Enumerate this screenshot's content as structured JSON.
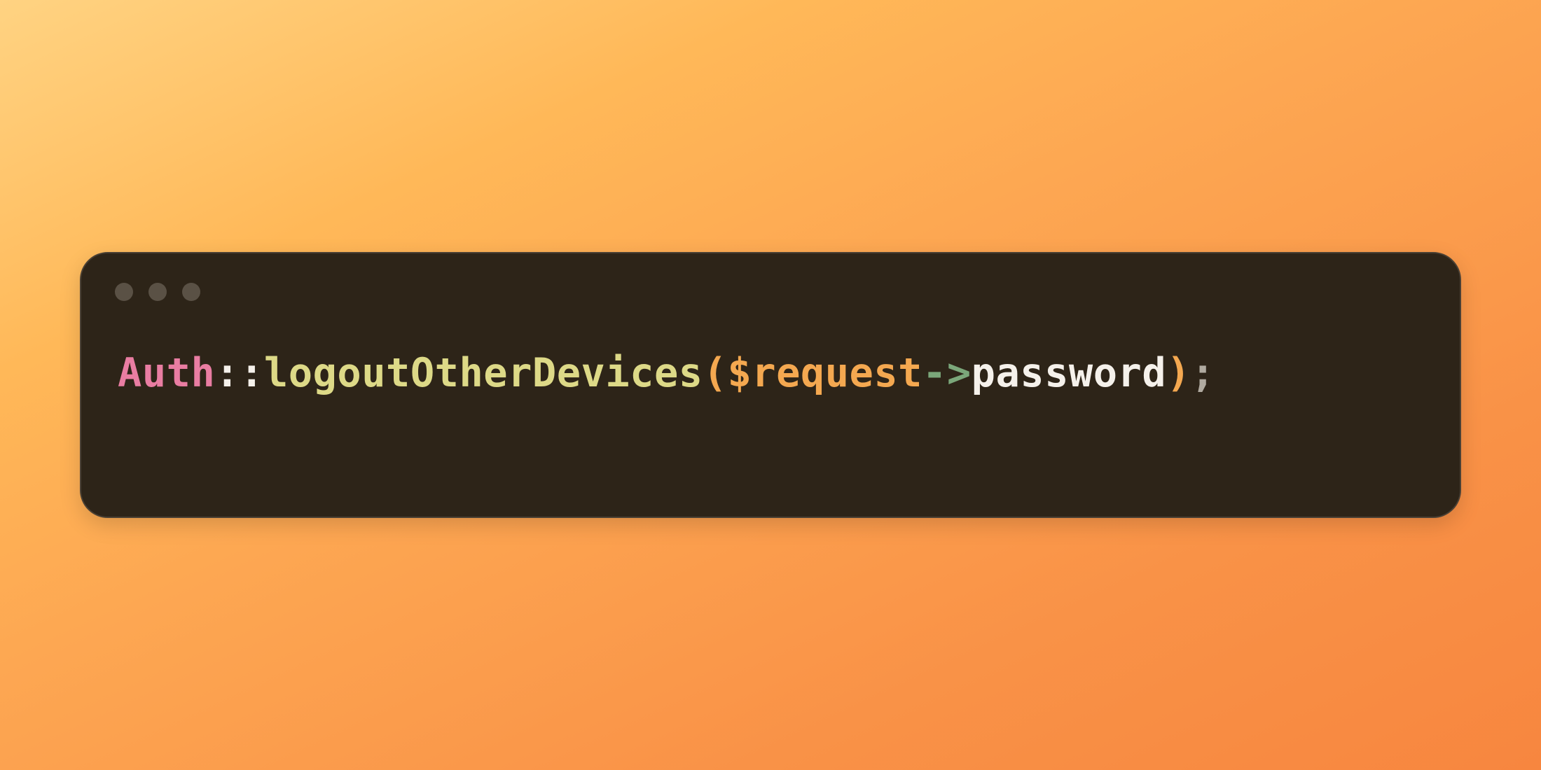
{
  "code": {
    "tokens": {
      "class_name": "Auth",
      "scope_op": "::",
      "method": "logoutOtherDevices",
      "paren_open": "(",
      "variable": "$request",
      "arrow": "->",
      "property": "password",
      "paren_close": ")",
      "semicolon": ";"
    }
  },
  "traffic_lights": [
    "close",
    "minimize",
    "maximize"
  ],
  "colors": {
    "window_bg": "#2D2418",
    "window_border": "#4A4034",
    "dot": "#5A5145",
    "class": "#E97DA2",
    "punc": "#F5F1EB",
    "func": "#DDD987",
    "paren_var": "#F4A850",
    "op": "#7BA77A",
    "semi": "#B0AAA0"
  }
}
